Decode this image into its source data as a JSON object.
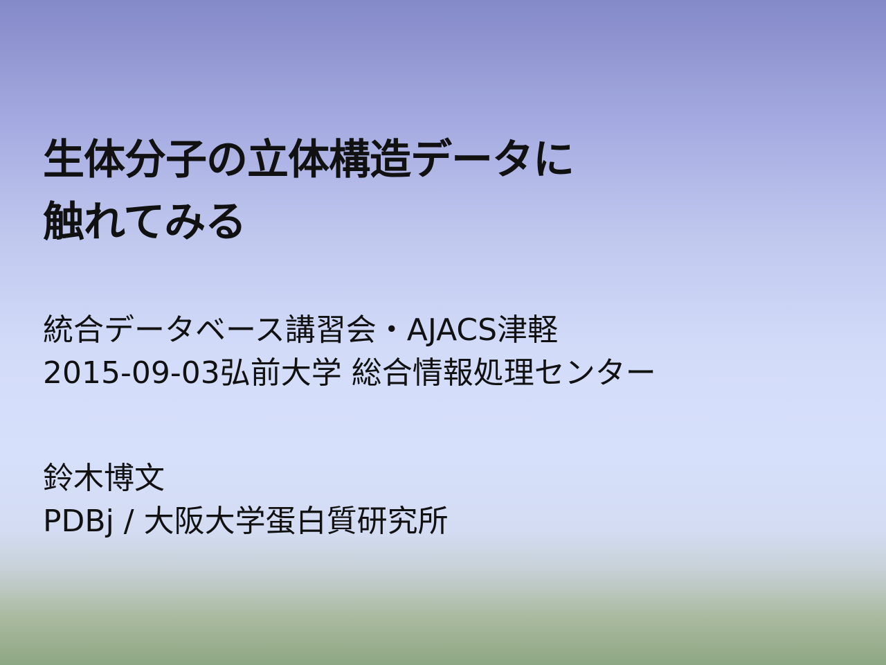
{
  "title": {
    "line1": "生体分子の立体構造データに",
    "line2": "触れてみる"
  },
  "event": {
    "name": "統合データベース講習会・AJACS津軽",
    "date_venue": "2015-09-03弘前大学 総合情報処理センター"
  },
  "author": {
    "name": "鈴木博文",
    "affiliation": "PDBj / 大阪大学蛋白質研究所"
  }
}
